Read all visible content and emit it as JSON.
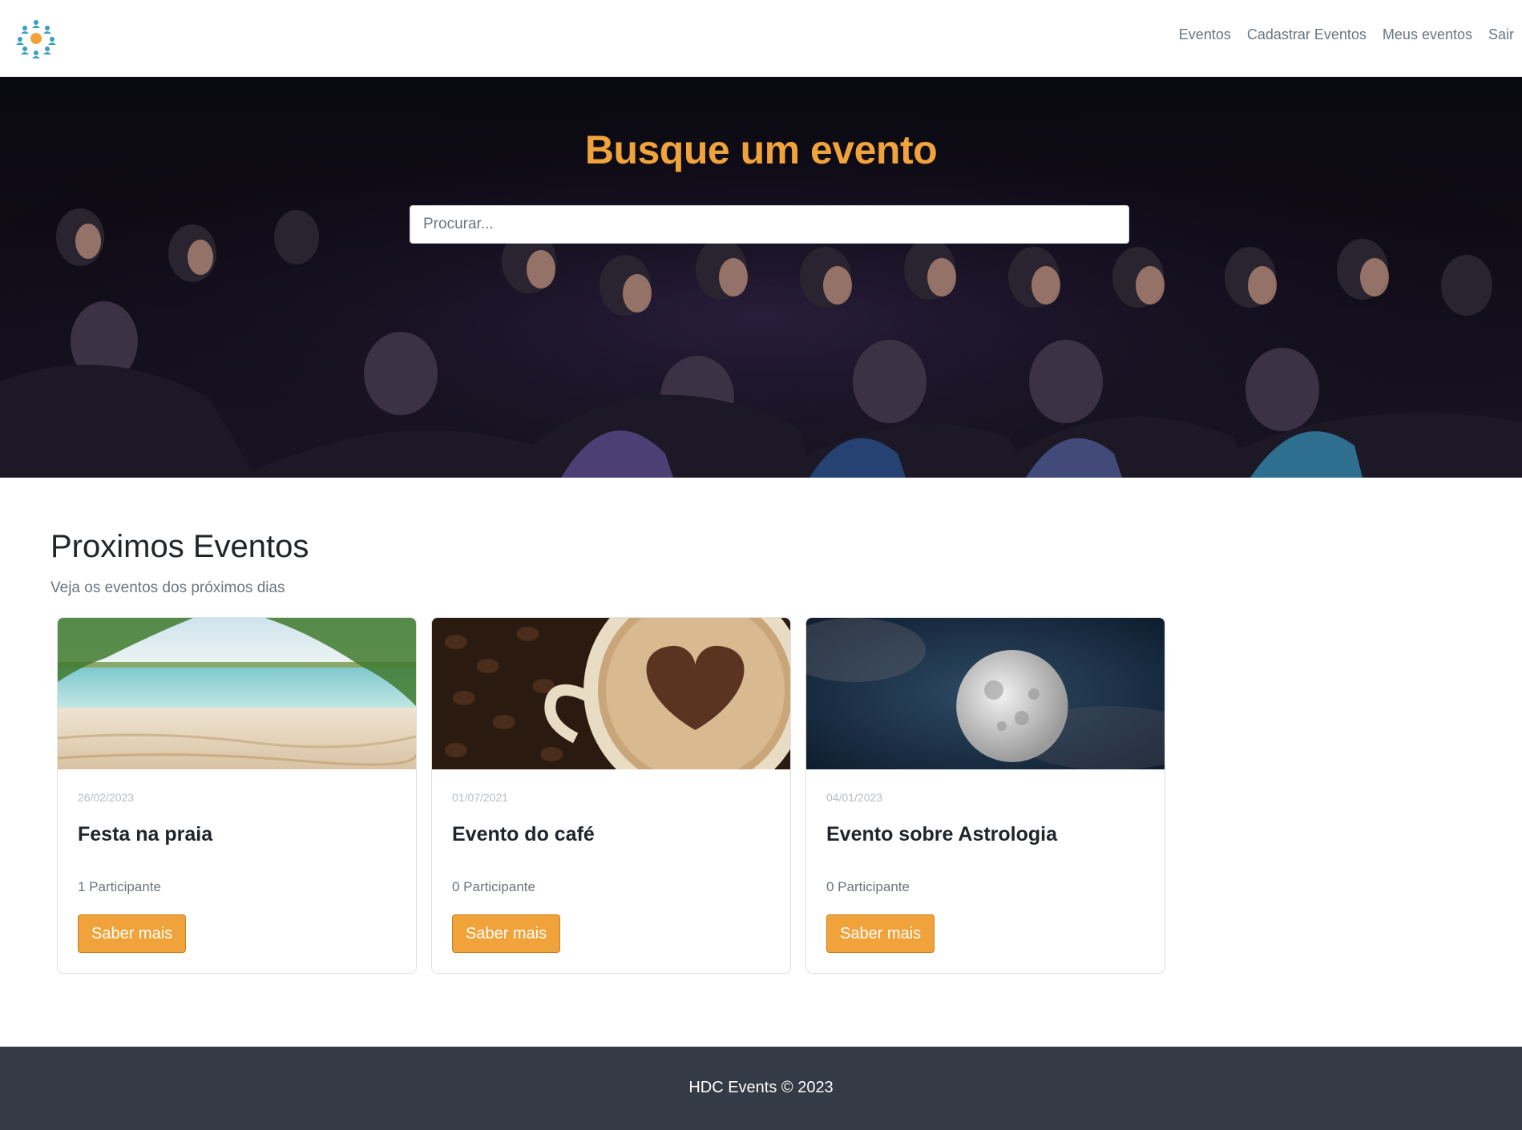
{
  "nav": {
    "links": [
      "Eventos",
      "Cadastrar Eventos",
      "Meus eventos",
      "Sair"
    ]
  },
  "hero": {
    "title": "Busque um evento",
    "search_placeholder": "Procurar..."
  },
  "events_section": {
    "title": "Proximos Eventos",
    "subtitle": "Veja os eventos dos próximos dias",
    "cards": [
      {
        "date": "26/02/2023",
        "title": "Festa na praia",
        "participants": "1 Participante",
        "button": "Saber mais",
        "image": "beach-image"
      },
      {
        "date": "01/07/2021",
        "title": "Evento do café",
        "participants": "0 Participante",
        "button": "Saber mais",
        "image": "coffee-image"
      },
      {
        "date": "04/01/2023",
        "title": "Evento sobre Astrologia",
        "participants": "0 Participante",
        "button": "Saber mais",
        "image": "moon-image"
      }
    ]
  },
  "footer": {
    "text": "HDC Events © 2023"
  },
  "colors": {
    "accent": "#f1a33b",
    "footer_bg": "#343a46",
    "muted": "#6c757d"
  }
}
